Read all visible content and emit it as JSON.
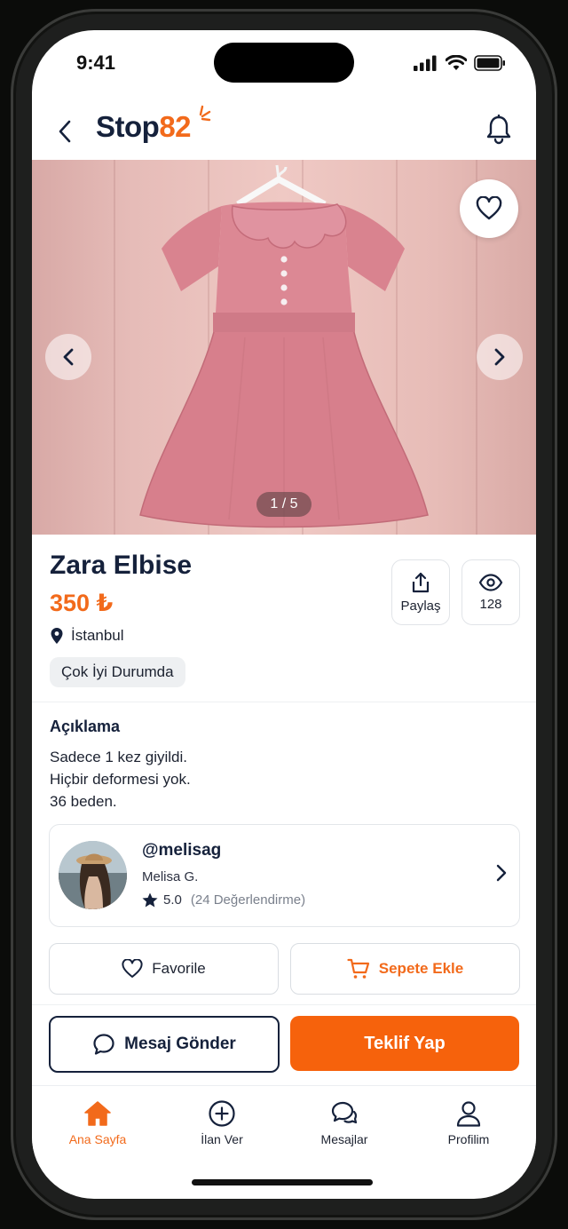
{
  "status_bar": {
    "time": "9:41"
  },
  "header": {
    "logo_primary": "Stop",
    "logo_accent": "82",
    "brand_color": "#f26a1b",
    "navy_color": "#15213b"
  },
  "gallery": {
    "counter": "1 / 5",
    "current_image": 1,
    "total_images": 5
  },
  "product": {
    "title": "Zara Elbise",
    "price": "350 ₺",
    "location": "İstanbul",
    "condition": "Çok İyi Durumda"
  },
  "stats": {
    "share_label": "Paylaş",
    "views": "128"
  },
  "description": {
    "heading": "Açıklama",
    "lines": [
      "Sadece 1 kez giyildi.",
      "Hiçbir deformesi yok.",
      "36 beden."
    ]
  },
  "seller": {
    "handle": "@melisag",
    "name": "Melisa G.",
    "rating": "5.0",
    "reviews": "(24 Değerlendirme)"
  },
  "actions": {
    "favorite": "Favorile",
    "add_to_cart": "Sepete Ekle",
    "message": "Mesaj Gönder",
    "offer": "Teklif Yap"
  },
  "tabs": [
    {
      "label": "Ana Sayfa",
      "icon": "home-icon",
      "active": true
    },
    {
      "label": "İlan Ver",
      "icon": "plus-circle-icon",
      "active": false
    },
    {
      "label": "Mesajlar",
      "icon": "chat-icon",
      "active": false
    },
    {
      "label": "Profilim",
      "icon": "user-icon",
      "active": false
    }
  ]
}
